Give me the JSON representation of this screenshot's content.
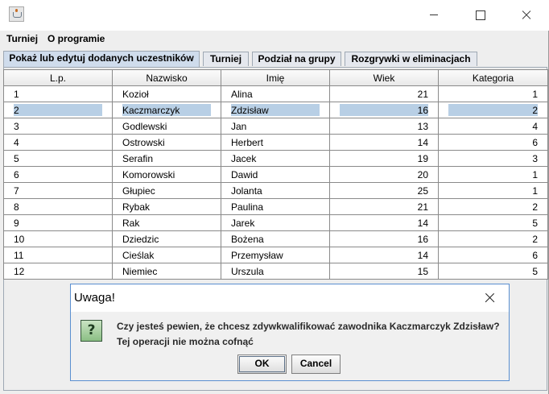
{
  "window": {
    "title": ""
  },
  "menu": [
    "Turniej",
    "O programie"
  ],
  "tabs": [
    "Pokaż lub edytuj dodanych uczestników",
    "Turniej",
    "Podział na grupy",
    "Rozgrywki w eliminacjach"
  ],
  "table": {
    "columns": [
      "L.p.",
      "Nazwisko",
      "Imię",
      "Wiek",
      "Kategoria"
    ],
    "rows": [
      [
        "1",
        "Kozioł",
        "Alina",
        "21",
        "1"
      ],
      [
        "2",
        "Kaczmarczyk",
        "Zdzisław",
        "16",
        "2"
      ],
      [
        "3",
        "Godlewski",
        "Jan",
        "13",
        "4"
      ],
      [
        "4",
        "Ostrowski",
        "Herbert",
        "14",
        "6"
      ],
      [
        "5",
        "Serafin",
        "Jacek",
        "19",
        "3"
      ],
      [
        "6",
        "Komorowski",
        "Dawid",
        "20",
        "1"
      ],
      [
        "7",
        "Głupiec",
        "Jolanta",
        "25",
        "1"
      ],
      [
        "8",
        "Rybak",
        "Paulina",
        "21",
        "2"
      ],
      [
        "9",
        "Rak",
        "Jarek",
        "14",
        "5"
      ],
      [
        "10",
        "Dziedzic",
        "Bożena",
        "16",
        "2"
      ],
      [
        "11",
        "Cieślak",
        "Przemysław",
        "14",
        "6"
      ],
      [
        "12",
        "Niemiec",
        "Urszula",
        "15",
        "5"
      ]
    ],
    "selected_row": 2
  },
  "dialog": {
    "title": "Uwaga!",
    "icon": "question-icon",
    "line1": "Czy jesteś pewien, że chcesz zdywkwalifikować zawodnika Kaczmarczyk Zdzisław?",
    "line2": "Tej operacji nie można cofnąć",
    "ok": "OK",
    "cancel": "Cancel"
  }
}
